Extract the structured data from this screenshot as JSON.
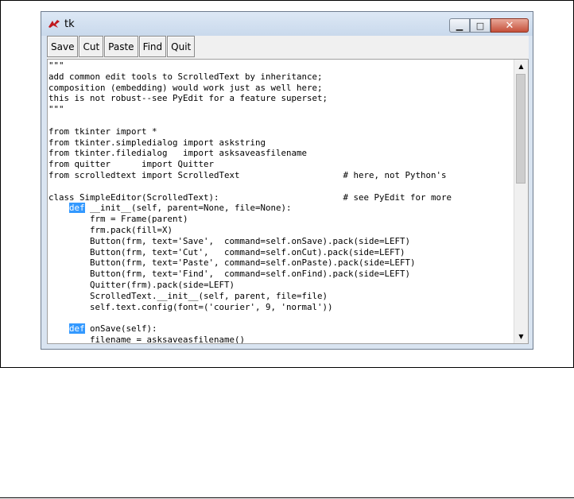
{
  "window": {
    "title": "tk",
    "controls": {
      "minimize": "▁",
      "maximize": "□",
      "close": "✕"
    }
  },
  "toolbar": {
    "buttons": [
      "Save",
      "Cut",
      "Paste",
      "Find",
      "Quit"
    ]
  },
  "editor": {
    "lines": [
      "\"\"\"",
      "add common edit tools to ScrolledText by inheritance;",
      "composition (embedding) would work just as well here;",
      "this is not robust--see PyEdit for a feature superset;",
      "\"\"\"",
      "",
      "from tkinter import *",
      "from tkinter.simpledialog import askstring",
      "from tkinter.filedialog   import asksaveasfilename",
      "from quitter      import Quitter",
      "from scrolledtext import ScrolledText                    # here, not Python's",
      "",
      "class SimpleEditor(ScrolledText):                        # see PyEdit for more",
      "    def __init__(self, parent=None, file=None):",
      "        frm = Frame(parent)",
      "        frm.pack(fill=X)",
      "        Button(frm, text='Save',  command=self.onSave).pack(side=LEFT)",
      "        Button(frm, text='Cut',   command=self.onCut).pack(side=LEFT)",
      "        Button(frm, text='Paste', command=self.onPaste).pack(side=LEFT)",
      "        Button(frm, text='Find',  command=self.onFind).pack(side=LEFT)",
      "        Quitter(frm).pack(side=LEFT)",
      "        ScrolledText.__init__(self, parent, file=file)",
      "        self.text.config(font=('courier', 9, 'normal'))",
      "",
      "    def onSave(self):",
      "        filename = asksaveasfilename()"
    ]
  },
  "scrollbar": {
    "up_arrow": "▲",
    "down_arrow": "▼"
  },
  "colors": {
    "selection": "#3399ff",
    "window_frame": "#d9e4f1",
    "close_button": "#c5503a"
  }
}
